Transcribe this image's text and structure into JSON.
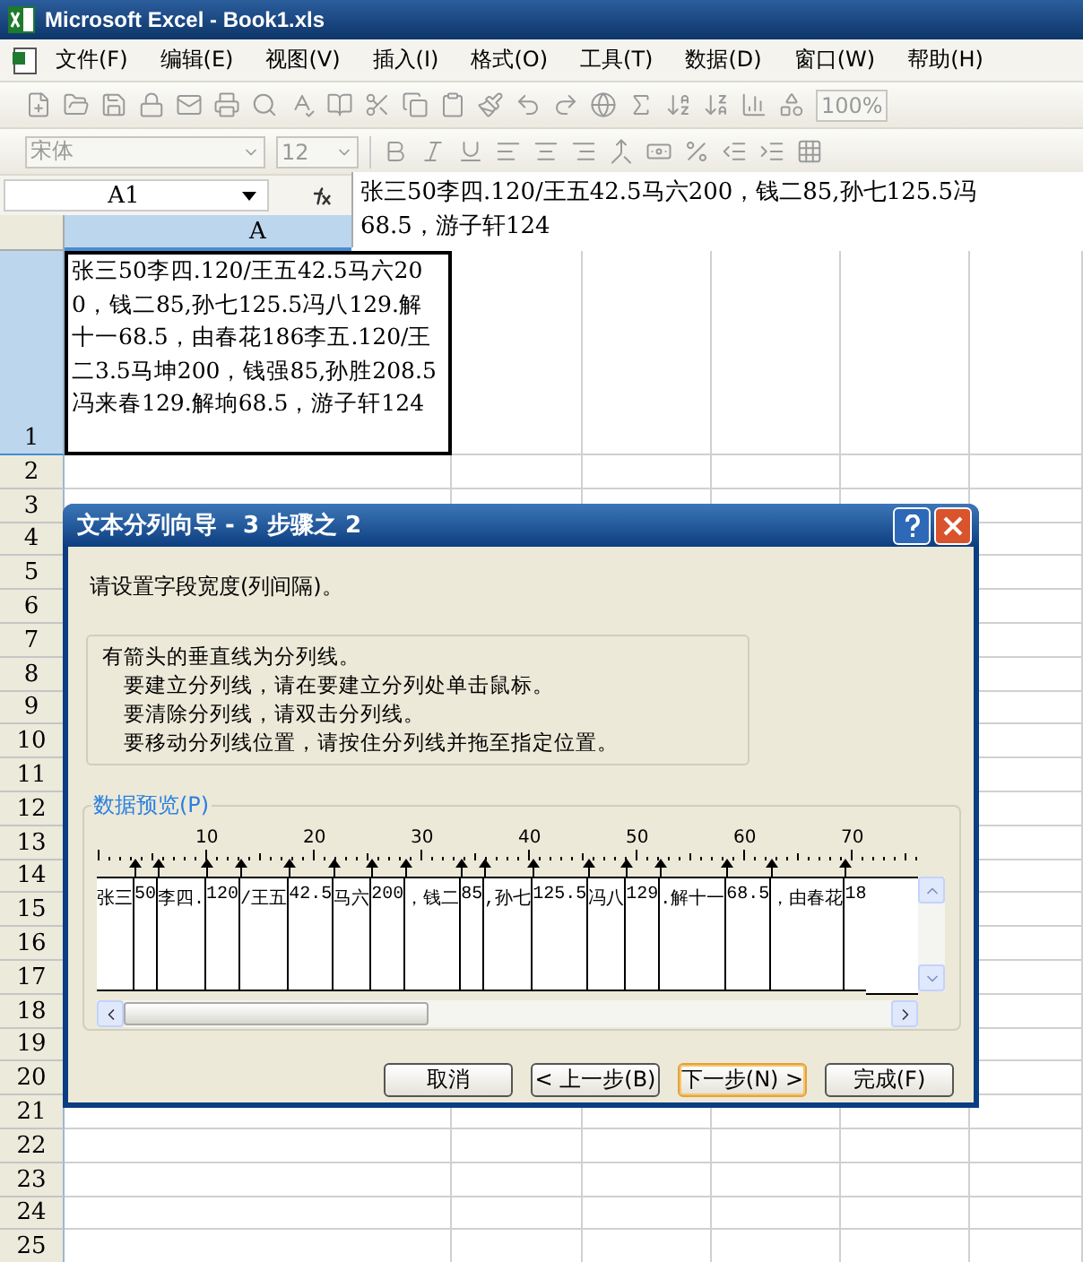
{
  "window": {
    "title": "Microsoft Excel - Book1.xls"
  },
  "menu": [
    "文件(F)",
    "编辑(E)",
    "视图(V)",
    "插入(I)",
    "格式(O)",
    "工具(T)",
    "数据(D)",
    "窗口(W)",
    "帮助(H)"
  ],
  "toolbar": {
    "font": "宋体",
    "size": "12",
    "zoom": "100%"
  },
  "formula_bar": {
    "name_box": "A1",
    "lines": [
      "张三50李四.120/王五42.5马六200，钱二85,孙七125.5冯",
      "68.5，游子轩124"
    ]
  },
  "sheet": {
    "column_header": "A",
    "cell_a1": "张三50李四.120/王五42.5马六200，钱二85,孙七125.5冯八129.解十一68.5，由春花186李五.120/王二3.5马坤200，钱强85,孙胜208.5冯来春129.解垧68.5，游子轩124",
    "row_headers": [
      {
        "label": "1",
        "selected": true
      },
      {
        "label": "2",
        "selected": false
      },
      {
        "label": "3",
        "selected": false
      },
      {
        "label": "4",
        "selected": false
      },
      {
        "label": "5",
        "selected": false
      },
      {
        "label": "6",
        "selected": false
      },
      {
        "label": "7",
        "selected": false
      },
      {
        "label": "8",
        "selected": false
      },
      {
        "label": "9",
        "selected": false
      },
      {
        "label": "10",
        "selected": false
      },
      {
        "label": "11",
        "selected": false
      },
      {
        "label": "12",
        "selected": false
      },
      {
        "label": "13",
        "selected": false
      },
      {
        "label": "14",
        "selected": false
      },
      {
        "label": "15",
        "selected": false
      },
      {
        "label": "16",
        "selected": false
      },
      {
        "label": "17",
        "selected": false
      },
      {
        "label": "18",
        "selected": false
      },
      {
        "label": "19",
        "selected": false
      },
      {
        "label": "20",
        "selected": false
      },
      {
        "label": "21",
        "selected": false
      },
      {
        "label": "22",
        "selected": false
      },
      {
        "label": "23",
        "selected": false
      },
      {
        "label": "24",
        "selected": false
      },
      {
        "label": "25",
        "selected": false
      }
    ]
  },
  "dialog": {
    "title": "文本分列向导 - 3 步骤之 2",
    "prompt": "请设置字段宽度(列间隔)。",
    "hint_title": "有箭头的垂直线为分列线。",
    "hints": [
      "要建立分列线，请在要建立分列处单击鼠标。",
      "要清除分列线，请双击分列线。",
      "要移动分列线位置，请按住分列线并拖至指定位置。"
    ],
    "preview_label": "数据预览(P)",
    "ruler_labels": [
      "10",
      "20",
      "30",
      "40",
      "50",
      "60",
      "70"
    ],
    "preview_fields": [
      "张三",
      "50",
      "李四.",
      "120",
      "/王五",
      "42.5",
      "马六",
      "200",
      "，钱二",
      "85",
      ",孙七",
      "125.5",
      "冯八",
      "129",
      ".解十一",
      "68.5",
      "，由春花",
      "18"
    ],
    "buttons": [
      {
        "label": "取消",
        "focused": false
      },
      {
        "label": "< 上一步(B)",
        "focused": false
      },
      {
        "label": "下一步(N) >",
        "focused": true
      },
      {
        "label": "完成(F)",
        "focused": false
      }
    ]
  }
}
